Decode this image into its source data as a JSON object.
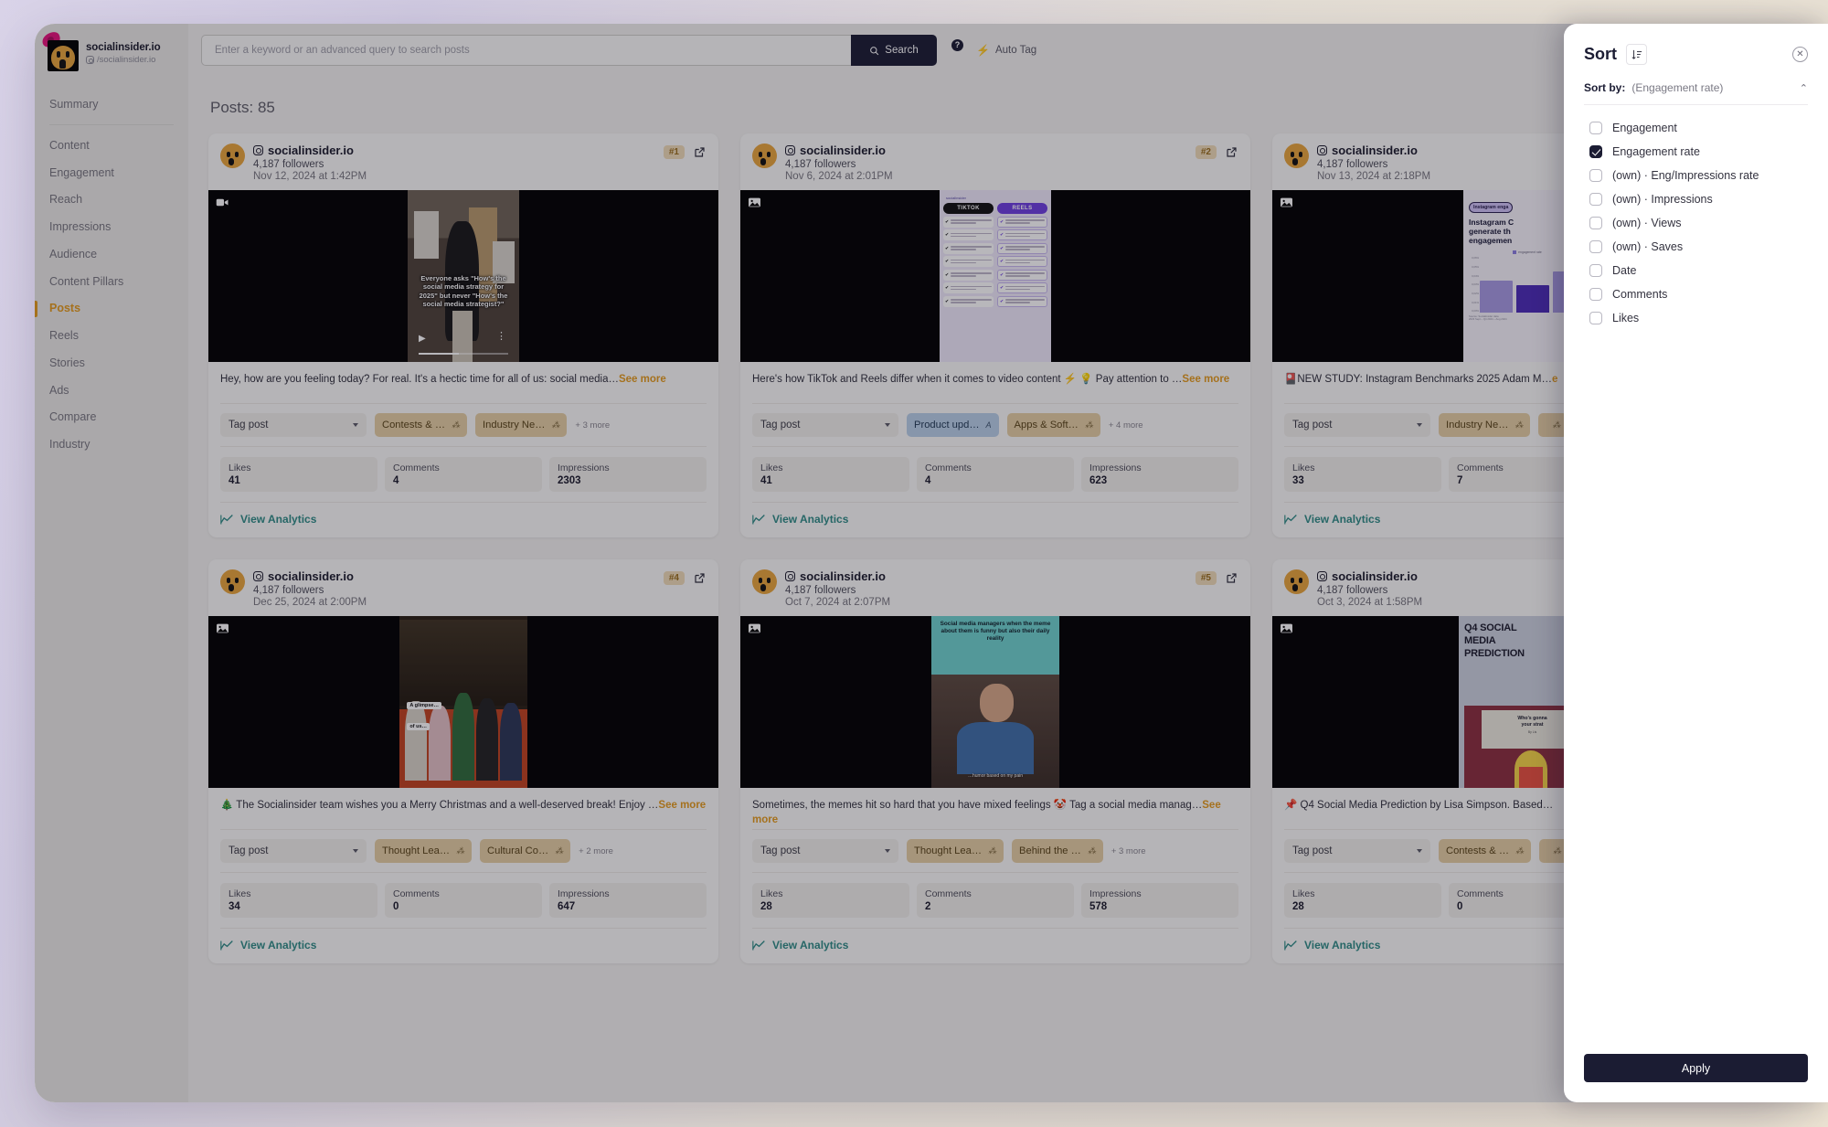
{
  "sidebar": {
    "brand": {
      "name": "socialinsider.io",
      "handle": "/socialinsider.io",
      "handle_icon": "instagram-icon"
    },
    "items": [
      {
        "label": "Summary",
        "active": false
      },
      {
        "label": "Content",
        "active": false
      },
      {
        "label": "Engagement",
        "active": false
      },
      {
        "label": "Reach",
        "active": false
      },
      {
        "label": "Impressions",
        "active": false
      },
      {
        "label": "Audience",
        "active": false
      },
      {
        "label": "Content Pillars",
        "active": false
      },
      {
        "label": "Posts",
        "active": true
      },
      {
        "label": "Reels",
        "active": false
      },
      {
        "label": "Stories",
        "active": false
      },
      {
        "label": "Ads",
        "active": false
      },
      {
        "label": "Compare",
        "active": false
      },
      {
        "label": "Industry",
        "active": false
      }
    ]
  },
  "topbar": {
    "search_placeholder": "Enter a keyword or an advanced query to search posts",
    "search_value": "",
    "search_button": "Search",
    "help_icon": "question-mark-icon",
    "auto_tag": "Auto Tag",
    "auto_tag_icon": "bolt-icon"
  },
  "main": {
    "posts_title": "Posts: 85"
  },
  "cards": [
    {
      "channel": "socialinsider.io",
      "followers": "4,187 followers",
      "date": "Nov 12, 2024 at 1:42PM",
      "rank": "#1",
      "media_type": "video",
      "caption": "Hey, how are you feeling today? For real. It's a hectic time for all of us: social media…",
      "see_more": "See more",
      "tag_select": "Tag post",
      "tags": [
        {
          "label": "Contests & …",
          "style": "tan",
          "icon": "sparkle-icon"
        },
        {
          "label": "Industry Ne…",
          "style": "tan",
          "icon": "sparkle-icon"
        }
      ],
      "more_tags": "+ 3 more",
      "metrics": [
        {
          "label": "Likes",
          "value": "41"
        },
        {
          "label": "Comments",
          "value": "4"
        },
        {
          "label": "Impressions",
          "value": "2303"
        }
      ],
      "analytics": "View Analytics",
      "overlay_text": "Everyone asks \"How's the social media strategy for 2025\" but never \"How's the social media strategist?\""
    },
    {
      "channel": "socialinsider.io",
      "followers": "4,187 followers",
      "date": "Nov 6, 2024 at 2:01PM",
      "rank": "#2",
      "media_type": "image",
      "caption": "Here's how TikTok and Reels differ when it comes to video content ⚡ 💡 Pay attention to …",
      "see_more": "See more",
      "tag_select": "Tag post",
      "tags": [
        {
          "label": "Product upd…",
          "style": "blue",
          "icon": "ai-icon"
        },
        {
          "label": "Apps & Soft…",
          "style": "tan",
          "icon": "sparkle-icon"
        }
      ],
      "more_tags": "+ 4 more",
      "metrics": [
        {
          "label": "Likes",
          "value": "41"
        },
        {
          "label": "Comments",
          "value": "4"
        },
        {
          "label": "Impressions",
          "value": "623"
        }
      ],
      "analytics": "View Analytics",
      "compare_left": "TIKTOK",
      "compare_right": "REELS"
    },
    {
      "channel": "socialinsider.io",
      "followers": "4,187 followers",
      "date": "Nov 13, 2024 at 2:18PM",
      "rank": "",
      "media_type": "image",
      "caption": "🎴NEW STUDY: Instagram Benchmarks 2025 Adam M…",
      "see_more": "e",
      "tag_select": "Tag post",
      "tags": [
        {
          "label": "Industry Ne…",
          "style": "tan",
          "icon": "sparkle-icon"
        },
        {
          "label": "",
          "style": "tan",
          "icon": "sparkle-icon"
        }
      ],
      "more_tags": "",
      "metrics": [
        {
          "label": "Likes",
          "value": "33"
        },
        {
          "label": "Comments",
          "value": "7"
        }
      ],
      "analytics": "View Analytics",
      "bench_pill": "Instagram enga",
      "bench_title": "Instagram C\ngenerate th\nengagemen",
      "bench_legend": "engagement rate",
      "bench_yticks": [
        "0,06%",
        "0,05%",
        "0,04%",
        "0,03%",
        "0,02%",
        "0,01%",
        "0,00%"
      ],
      "bench_source": "Source: Socialinsider data\n2023 Sept – Q4 2024 – Aug 2024"
    },
    {
      "channel": "socialinsider.io",
      "followers": "4,187 followers",
      "date": "Dec 25, 2024 at 2:00PM",
      "rank": "#4",
      "media_type": "image",
      "caption": "🎄 The Socialinsider team wishes you a Merry Christmas and a well-deserved break! Enjoy …",
      "see_more": "See more",
      "tag_select": "Tag post",
      "tags": [
        {
          "label": "Thought Lea…",
          "style": "tan",
          "icon": "sparkle-icon"
        },
        {
          "label": "Cultural Co…",
          "style": "tan",
          "icon": "sparkle-icon"
        }
      ],
      "more_tags": "+ 2 more",
      "metrics": [
        {
          "label": "Likes",
          "value": "34"
        },
        {
          "label": "Comments",
          "value": "0"
        },
        {
          "label": "Impressions",
          "value": "647"
        }
      ],
      "analytics": "View Analytics",
      "sticker_1": "A glimpse…",
      "sticker_2": "of us…"
    },
    {
      "channel": "socialinsider.io",
      "followers": "4,187 followers",
      "date": "Oct 7, 2024 at 2:07PM",
      "rank": "#5",
      "media_type": "image",
      "caption": "Sometimes, the memes hit so hard that you have mixed feelings 🤡 Tag a social media manag…",
      "see_more": "See more",
      "tag_select": "Tag post",
      "tags": [
        {
          "label": "Thought Lea…",
          "style": "tan",
          "icon": "sparkle-icon"
        },
        {
          "label": "Behind the …",
          "style": "tan",
          "icon": "sparkle-icon"
        }
      ],
      "more_tags": "+ 3 more",
      "metrics": [
        {
          "label": "Likes",
          "value": "28"
        },
        {
          "label": "Comments",
          "value": "2"
        },
        {
          "label": "Impressions",
          "value": "578"
        }
      ],
      "analytics": "View Analytics",
      "meme_caption": "Social media managers when the meme about them is funny but also their daily reality",
      "meme_sub": "…humor based on my pain"
    },
    {
      "channel": "socialinsider.io",
      "followers": "4,187 followers",
      "date": "Oct 3, 2024 at 1:58PM",
      "rank": "",
      "media_type": "image",
      "caption": "📌 Q4 Social Media Prediction by Lisa Simpson. Based…",
      "see_more": "",
      "tag_select": "Tag post",
      "tags": [
        {
          "label": "Contests & …",
          "style": "tan",
          "icon": "sparkle-icon"
        },
        {
          "label": "",
          "style": "tan",
          "icon": "sparkle-icon"
        }
      ],
      "more_tags": "",
      "metrics": [
        {
          "label": "Likes",
          "value": "28"
        },
        {
          "label": "Comments",
          "value": "0"
        }
      ],
      "analytics": "View Analytics",
      "q4_title": "Q4 SOCIAL\nMEDIA\nPREDICTION",
      "q4_screen_1": "Who's gonna\nyour strat",
      "q4_screen_2": "By Lis"
    }
  ],
  "sort_panel": {
    "title": "Sort",
    "sort_icon": "sort-descending-icon",
    "close_icon": "close-circle-icon",
    "sort_by_label": "Sort by:",
    "sort_by_value": "(Engagement rate)",
    "collapse_icon": "chevron-up-icon",
    "options": [
      {
        "label": "Engagement",
        "checked": false
      },
      {
        "label": "Engagement rate",
        "checked": true
      },
      {
        "label": "(own) · Eng/Impressions rate",
        "checked": false
      },
      {
        "label": "(own) · Impressions",
        "checked": false
      },
      {
        "label": "(own) · Views",
        "checked": false
      },
      {
        "label": "(own) · Saves",
        "checked": false
      },
      {
        "label": "Date",
        "checked": false
      },
      {
        "label": "Comments",
        "checked": false
      },
      {
        "label": "Likes",
        "checked": false
      }
    ],
    "apply_label": "Apply"
  },
  "colors": {
    "accent_orange": "#e49b1d",
    "dark": "#1b1c33",
    "teal": "#2e8c86",
    "tag_tan": "#e5cfa4",
    "tag_blue": "#b9d0e8"
  }
}
